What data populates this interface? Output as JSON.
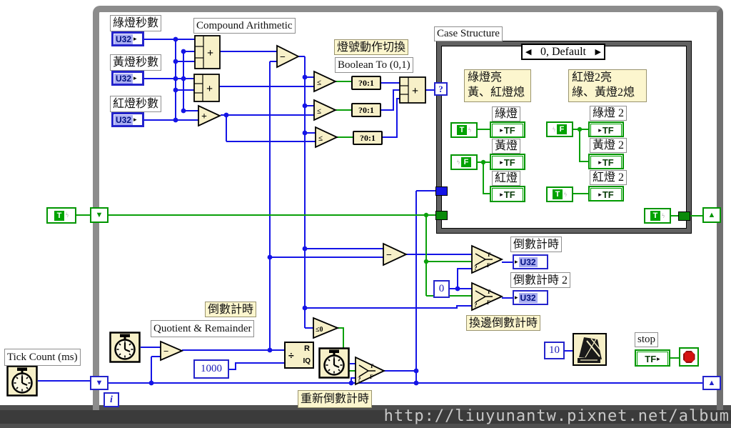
{
  "watermark": "http://liuyunantw.pixnet.net/album",
  "colors": {
    "wire_blue": "#1414E6",
    "wire_green": "#0AA00A",
    "node_fill": "#F7F0C8",
    "label_yellow": "#FCF6CE",
    "stop_red": "#D51111"
  },
  "labels": {
    "green_seconds": "綠燈秒數",
    "yellow_seconds": "黃燈秒數",
    "red_seconds": "紅燈秒數",
    "compound_arithmetic": "Compound Arithmetic",
    "light_action_switch": "燈號動作切換",
    "boolean_to_01": "Boolean To (0,1)",
    "case_structure": "Case Structure",
    "green_on_line1": "綠燈亮",
    "green_on_line2": "黃、紅燈熄",
    "red2_on_line1": "紅燈2亮",
    "red2_on_line2": "綠、黃燈2熄",
    "countdown": "倒數計時",
    "countdown_2": "倒數計時 2",
    "countdown_note": "倒數計時",
    "side_switch_countdown": "換邊倒數計時",
    "restart_countdown": "重新倒數計時",
    "quotient_remainder": "Quotient & Remainder",
    "tick_count_ms": "Tick Count (ms)",
    "stop": "stop"
  },
  "case_lights": {
    "selector_label": "0, Default",
    "left": [
      {
        "label": "綠燈"
      },
      {
        "label": "黃燈"
      },
      {
        "label": "紅燈"
      }
    ],
    "right": [
      {
        "label": "綠燈 2"
      },
      {
        "label": "黃燈 2"
      },
      {
        "label": "紅燈 2"
      }
    ]
  },
  "values": {
    "u32": "U32",
    "tf": "TF",
    "true": "T",
    "false": "F",
    "ms_divisor": "1000",
    "zero": "0",
    "wait_ms": "10",
    "iteration": "i",
    "selector": "?",
    "bool_to_num": "?0:1"
  },
  "glyphs": {
    "plus": "+",
    "minus": "−",
    "less_equal": "≤",
    "less_equal_zero": "≤0",
    "select_s": "?",
    "select_t": "T",
    "select_f": "F",
    "divide": "÷",
    "remainder": "R",
    "quotient": "IQ",
    "terminal_arrow": "▸",
    "case_prev": "◀",
    "case_next": "▶",
    "shift_down": "▼",
    "shift_up": "▲",
    "const_marker": "ϟ"
  }
}
